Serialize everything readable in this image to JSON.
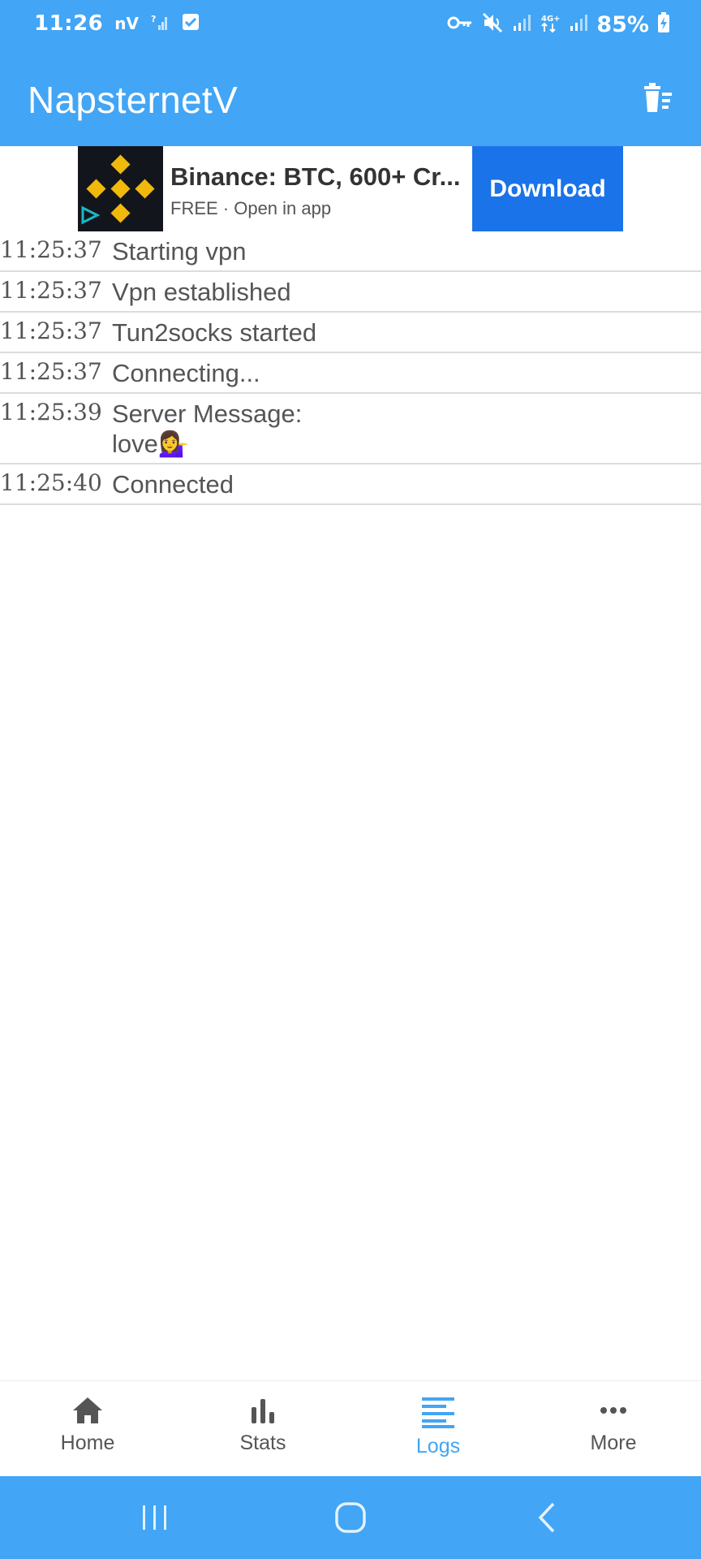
{
  "status_bar": {
    "time": "11:26",
    "carrier": "nV",
    "battery": "85%",
    "icons": [
      "signal-question-icon",
      "check-box-icon",
      "vpn-key-icon",
      "mute-icon",
      "signal-icon",
      "4g-icon",
      "signal-icon",
      "battery-charging-icon"
    ]
  },
  "app_bar": {
    "title": "NapsternetV",
    "action_icon": "delete-sweep-icon"
  },
  "ad": {
    "title": "Binance: BTC, 600+ Cr...",
    "subtitle": "FREE · Open in app",
    "button_label": "Download",
    "logo_color": "#f0b90b"
  },
  "logs": [
    {
      "time": "11:25:37",
      "message": "Starting vpn"
    },
    {
      "time": "11:25:37",
      "message": "Vpn established"
    },
    {
      "time": "11:25:37",
      "message": "Tun2socks started"
    },
    {
      "time": "11:25:37",
      "message": "Connecting..."
    },
    {
      "time": "11:25:39",
      "message": "Server Message:",
      "message_line2": "love💁‍♀️"
    },
    {
      "time": "11:25:40",
      "message": "Connected"
    }
  ],
  "bottom_nav": {
    "items": [
      {
        "label": "Home",
        "icon": "home-icon",
        "active": false
      },
      {
        "label": "Stats",
        "icon": "bar-chart-icon",
        "active": false
      },
      {
        "label": "Logs",
        "icon": "logs-icon",
        "active": true
      },
      {
        "label": "More",
        "icon": "more-icon",
        "active": false
      }
    ]
  },
  "colors": {
    "accent": "#42a5f5",
    "ad_button": "#1a73e8",
    "text": "#555555"
  }
}
